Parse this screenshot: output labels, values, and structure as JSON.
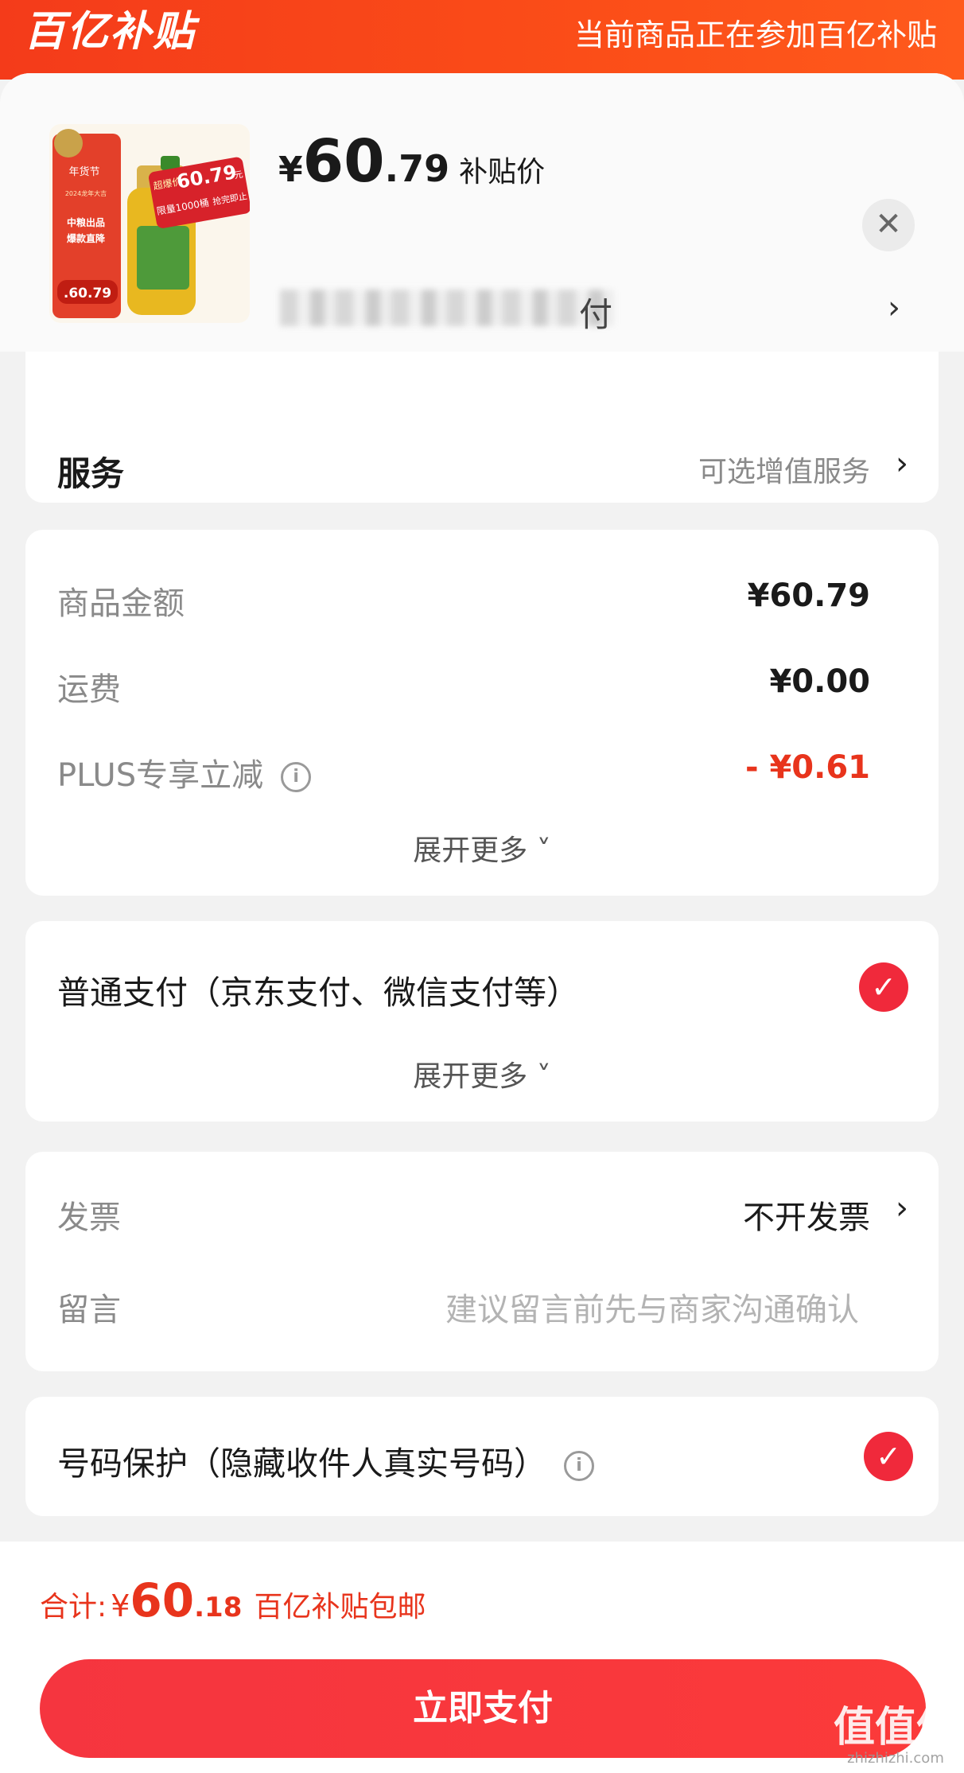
{
  "banner": {
    "logo_text": "百亿补贴",
    "notice": "当前商品正在参加百亿补贴"
  },
  "product": {
    "price_symbol": "¥",
    "price_int": "60",
    "price_dec": ".79",
    "price_tag": "补贴价",
    "name_visible_tail": "付",
    "thumbnail": {
      "badge_top": "年货节",
      "badge_sub": "2024龙年大吉",
      "promo_line1": "中粮出品",
      "promo_line2": "爆款直降",
      "price_pill": ".60.79",
      "burst_price": "60.79",
      "burst_prefix": "超爆价",
      "burst_unit": "元",
      "burst_limit": "限量1000桶",
      "burst_sold": "抢完即止"
    }
  },
  "service": {
    "label": "服务",
    "value": "可选增值服务"
  },
  "amounts": {
    "goods_label": "商品金额",
    "goods_value": "¥60.79",
    "shipping_label": "运费",
    "shipping_value": "¥0.00",
    "plus_label": "PLUS专享立减",
    "plus_value": "- ¥0.61",
    "expand_label": "展开更多"
  },
  "payment": {
    "method": "普通支付（京东支付、微信支付等）",
    "expand_label": "展开更多"
  },
  "invoice": {
    "label": "发票",
    "value": "不开发票"
  },
  "note": {
    "label": "留言",
    "placeholder": "建议留言前先与商家沟通确认"
  },
  "privacy": {
    "label": "号码保护（隐藏收件人真实号码）"
  },
  "footer": {
    "total_label": "合计:",
    "total_symbol": "¥",
    "total_int": "60",
    "total_dec": ".18",
    "total_note": "百亿补贴包邮",
    "pay_label": "立即支付",
    "watermark_main": "值值值",
    "watermark_sub": "zhizhizhi.com"
  },
  "colors": {
    "brand_red": "#e8341c",
    "banner_orange": "#fb4d18",
    "check_red": "#f0293b"
  }
}
